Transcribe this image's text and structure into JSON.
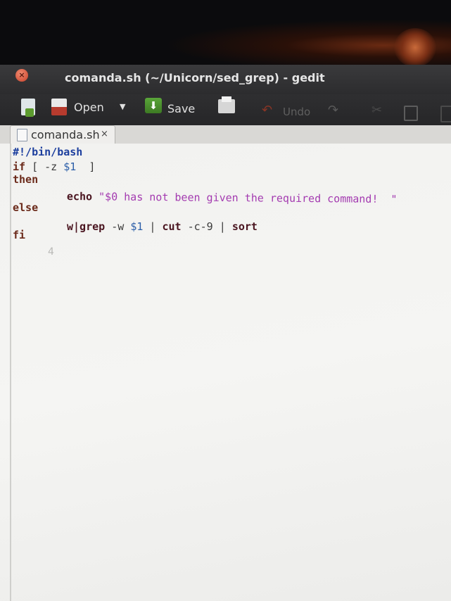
{
  "window": {
    "title": "comanda.sh (~/Unicorn/sed_grep) - gedit",
    "close_glyph": "×"
  },
  "toolbar": {
    "open_label": "Open",
    "save_label": "Save",
    "undo_label": "Undo"
  },
  "tab": {
    "label": "comanda.sh",
    "close_glyph": "×"
  },
  "code": {
    "line1": "#!/bin/bash",
    "line2": {
      "kw": "if",
      "rest1": " [ -z ",
      "var": "$1",
      "rest2": "  ]"
    },
    "line3": {
      "kw": "then"
    },
    "line4": {
      "cmd": "echo",
      "str": " \"$0 has not been given the required command!  \""
    },
    "line5": {
      "kw": "else"
    },
    "line6": {
      "cmd1": "w|grep",
      "rest1": " -w ",
      "var": "$1",
      "rest2": " | ",
      "cmd2": "cut",
      "rest3": " -c-9 | ",
      "cmd3": "sort"
    },
    "line7": {
      "kw": "fi"
    },
    "line8": "4"
  },
  "icons": [
    "new-document-icon",
    "open-icon",
    "save-icon",
    "print-icon",
    "undo-icon",
    "redo-icon",
    "cut-icon",
    "copy-icon",
    "paste-icon"
  ]
}
